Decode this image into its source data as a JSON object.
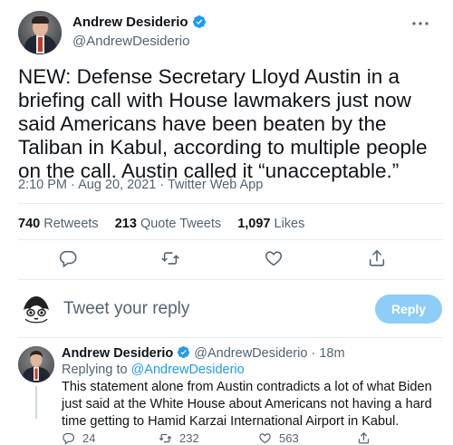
{
  "tweet": {
    "author_name": "Andrew Desiderio",
    "author_handle": "@AndrewDesiderio",
    "verified": true,
    "text": "NEW: Defense Secretary Lloyd Austin in a briefing call with House lawmakers just now said Americans have been beaten by the Taliban in Kabul, according to multiple people on the call. Austin called it “unacceptable.”",
    "meta": "2:10 PM · Aug 20, 2021 · Twitter Web App",
    "stats": {
      "retweets_count": "740",
      "retweets_label": "Retweets",
      "quotes_count": "213",
      "quotes_label": "Quote Tweets",
      "likes_count": "1,097",
      "likes_label": "Likes"
    },
    "actions": [
      "reply-icon",
      "retweet-icon",
      "like-icon",
      "share-icon"
    ]
  },
  "composer": {
    "placeholder": "Tweet your reply",
    "reply_button": "Reply"
  },
  "reply": {
    "author_name": "Andrew Desiderio",
    "author_handle": "@AndrewDesiderio",
    "time": "18m",
    "separator": "·",
    "replying_prefix": "Replying to",
    "replying_to": "@AndrewDesiderio",
    "text": "This statement alone from Austin contradicts a lot of what Biden just said at the White House about Americans not having a hard time getting to Hamid Karzai International Airport in Kabul.",
    "reply_count": "24",
    "retweet_count": "232",
    "like_count": "563"
  },
  "colors": {
    "accent": "#1d9bf0",
    "reply_button_disabled": "#8ecdf8",
    "secondary_text": "#536471",
    "divider": "#e6ebee"
  }
}
